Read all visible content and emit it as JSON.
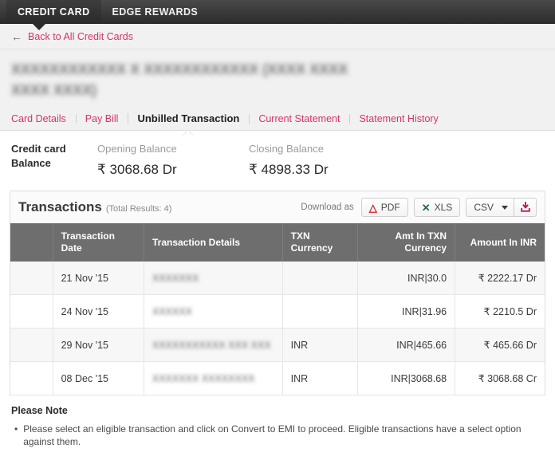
{
  "topnav": {
    "items": [
      {
        "label": "CREDIT CARD",
        "active": true
      },
      {
        "label": "EDGE REWARDS",
        "active": false
      }
    ]
  },
  "back": {
    "arrow_icon": "arrow-left-icon",
    "label": "Back to All Credit Cards"
  },
  "card": {
    "title_redacted": "XXXXXXXXXXXX X XXXXXXXXXXXX (XXXX XXXX XXXX XXXX)"
  },
  "subtabs": [
    {
      "label": "Card Details",
      "active": false
    },
    {
      "label": "Pay Bill",
      "active": false
    },
    {
      "label": "Unbilled Transaction",
      "active": true
    },
    {
      "label": "Current Statement",
      "active": false
    },
    {
      "label": "Statement History",
      "active": false
    }
  ],
  "balance": {
    "label": "Credit card Balance",
    "opening": {
      "caption": "Opening Balance",
      "value": "₹ 3068.68 Dr"
    },
    "closing": {
      "caption": "Closing Balance",
      "value": "₹ 4898.33 Dr"
    }
  },
  "transactions_panel": {
    "title": "Transactions",
    "subtitle": "(Total Results: 4)",
    "download_label": "Download as",
    "pdf_button": "PDF",
    "xls_button": "XLS",
    "csv_select_value": "CSV",
    "download_icon": "download-icon",
    "pdf_icon": "pdf-icon",
    "xls_icon": "xls-icon",
    "columns": [
      "",
      "Transaction Date",
      "Transaction Details",
      "TXN Currency",
      "Amt In TXN Currency",
      "Amount In INR"
    ],
    "rows": [
      {
        "date": "21 Nov '15",
        "details_redacted": "XXXXXXX",
        "txn_currency": "",
        "amt_txn_currency": "INR|30.0",
        "amount_inr": "₹ 2222.17 Dr"
      },
      {
        "date": "24 Nov '15",
        "details_redacted": "XXXXXX",
        "txn_currency": "",
        "amt_txn_currency": "INR|31.96",
        "amount_inr": "₹ 2210.5 Dr"
      },
      {
        "date": "29 Nov '15",
        "details_redacted": "XXXXXXXXXXX XXX XXX",
        "txn_currency": "INR",
        "amt_txn_currency": "INR|465.66",
        "amount_inr": "₹ 465.66 Dr"
      },
      {
        "date": "08 Dec '15",
        "details_redacted": "XXXXXXX XXXXXXXX",
        "txn_currency": "INR",
        "amt_txn_currency": "INR|3068.68",
        "amount_inr": "₹ 3068.68 Cr"
      }
    ]
  },
  "note": {
    "title": "Please Note",
    "bullet": "•",
    "items": [
      "Please select an eligible transaction and click on Convert to EMI to proceed. Eligible transactions have a select option against them."
    ]
  },
  "colors": {
    "accent_pink": "#d6336c",
    "nav_dark": "#2b2b2b",
    "table_header_gray": "#6e6e6e"
  }
}
